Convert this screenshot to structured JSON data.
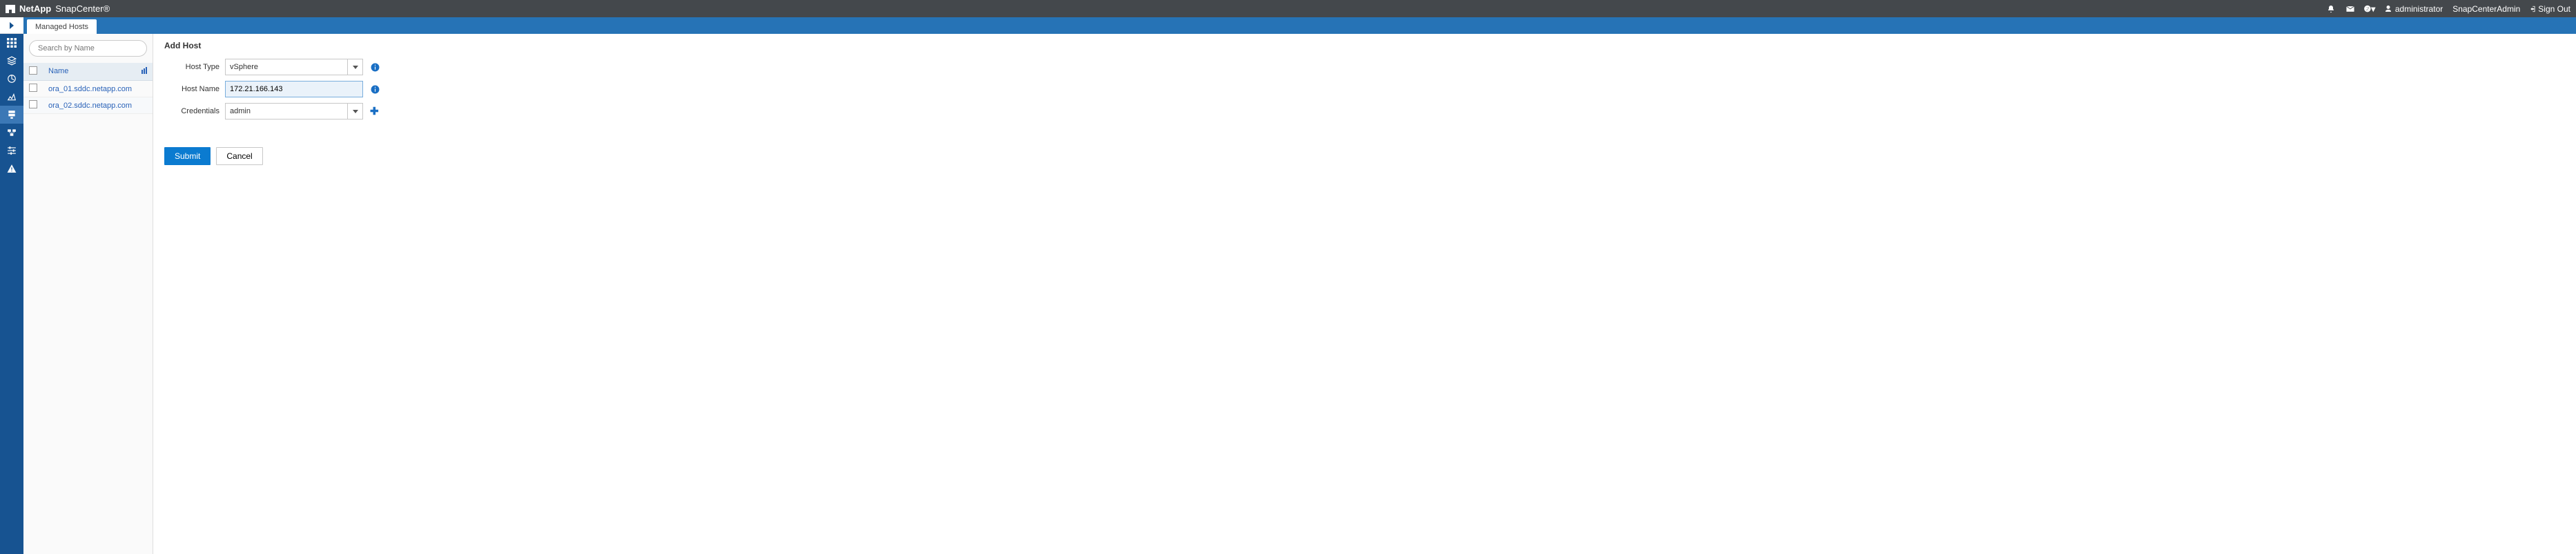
{
  "header": {
    "brand_company": "NetApp",
    "brand_product": "SnapCenter®",
    "user_name": "administrator",
    "role": "SnapCenterAdmin",
    "signout": "Sign Out"
  },
  "tabs": {
    "managed_hosts": "Managed Hosts"
  },
  "sidebar": {
    "search_placeholder": "Search by Name",
    "col_name": "Name",
    "hosts": [
      {
        "name": "ora_01.sddc.netapp.com"
      },
      {
        "name": "ora_02.sddc.netapp.com"
      }
    ]
  },
  "form": {
    "title": "Add Host",
    "host_type_label": "Host Type",
    "host_type_value": "vSphere",
    "host_name_label": "Host Name",
    "host_name_value": "172.21.166.143",
    "credentials_label": "Credentials",
    "credentials_value": "admin",
    "submit": "Submit",
    "cancel": "Cancel"
  }
}
